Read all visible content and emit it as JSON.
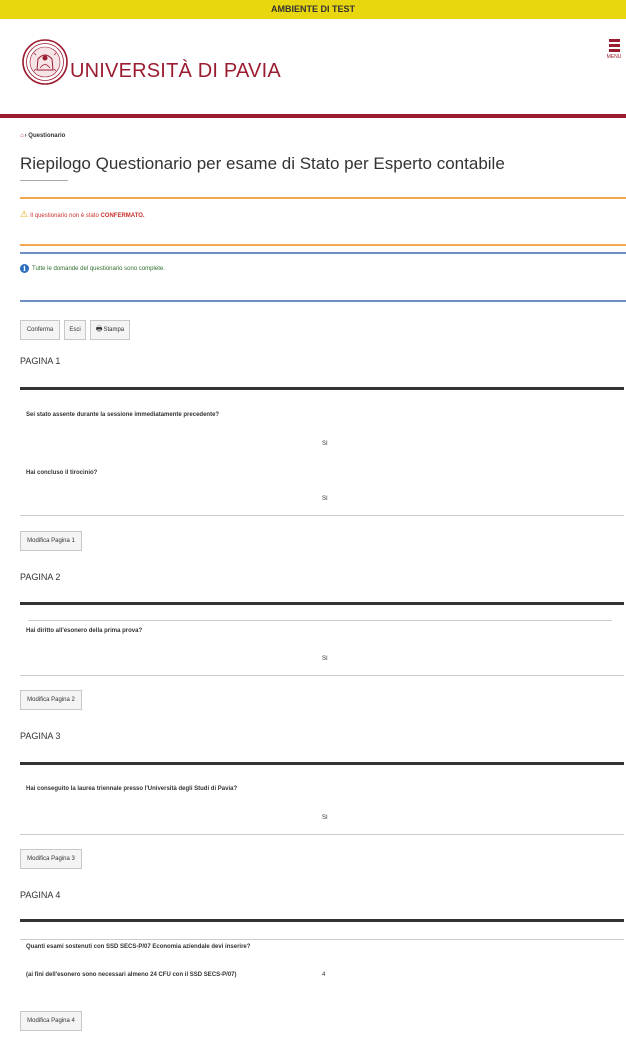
{
  "banner": "AMBIENTE DI TEST",
  "header": {
    "logo_text": "UNIVERSITÀ DI PAVIA",
    "menu_label": "MENU",
    "brand_color": "#9b1c31"
  },
  "breadcrumb": {
    "home_icon": "home-icon",
    "current": "Questionario"
  },
  "page_title": "Riepilogo Questionario per esame di Stato per Esperto contabile",
  "alerts": {
    "warning_pre": "Il questionario non è stato",
    "warning_strong": "CONFERMATO.",
    "info": "Tutte le domande del questionario sono complete."
  },
  "actions": {
    "confirm": "Conferma",
    "exit": "Esci",
    "print": "Stampa"
  },
  "pages": [
    {
      "title": "PAGINA 1",
      "questions": [
        {
          "q": "Sei stato assente durante la sessione immediatamente precedente?",
          "a": "SI"
        },
        {
          "q": "Hai concluso il tirocinio?",
          "a": "SI"
        }
      ],
      "edit_label": "Modifica Pagina 1"
    },
    {
      "title": "PAGINA 2",
      "questions": [
        {
          "q": "Hai diritto all'esonero della prima prova?",
          "a": "SI"
        }
      ],
      "edit_label": "Modifica Pagina 2"
    },
    {
      "title": "PAGINA 3",
      "questions": [
        {
          "q": "Hai conseguito la laurea triennale presso l'Università degli Studi di Pavia?",
          "a": "SI"
        }
      ],
      "edit_label": "Modifica Pagina 3"
    },
    {
      "title": "PAGINA 4",
      "questions": [
        {
          "q": "Quanti esami sostenuti con SSD SECS-P/07 Economia aziendale devi inserire?",
          "a": ""
        },
        {
          "q": "(ai fini dell'esonero sono necessari almeno 24 CFU con il SSD SECS-P/07)",
          "a": "4"
        }
      ],
      "edit_label": "Modifica Pagina 4"
    }
  ]
}
